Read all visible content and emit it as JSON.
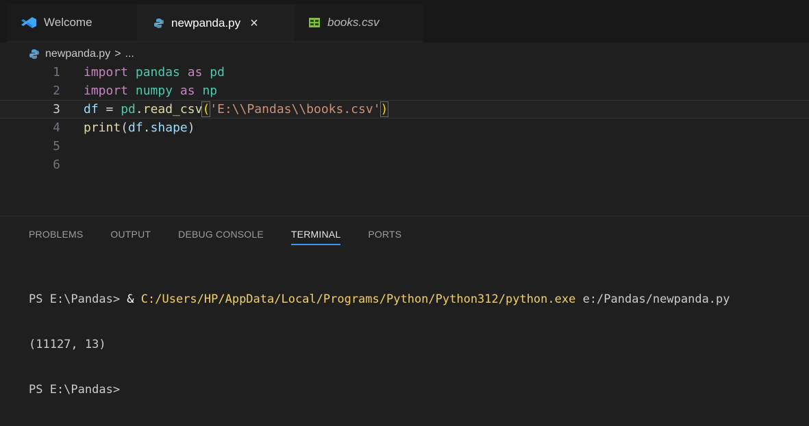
{
  "colors": {
    "background": "#1f1f1f",
    "tabbar": "#181818",
    "accent": "#3794ff",
    "python_icon": "#4da3d6",
    "csv_icon": "#7fbf3f",
    "vscode_icon": "#3ca6ff"
  },
  "tabs": [
    {
      "label": "Welcome",
      "icon": "vscode-icon",
      "active": false
    },
    {
      "label": "newpanda.py",
      "icon": "python-icon",
      "active": true,
      "close": "×"
    },
    {
      "label": "books.csv",
      "icon": "csv-icon",
      "active": false,
      "preview": true
    }
  ],
  "breadcrumb": {
    "file": "newpanda.py",
    "separator": ">",
    "rest": "..."
  },
  "editor": {
    "lines": [
      {
        "number": "1"
      },
      {
        "number": "2"
      },
      {
        "number": "3",
        "current": true
      },
      {
        "number": "4"
      },
      {
        "number": "5"
      },
      {
        "number": "6"
      }
    ],
    "tokens": {
      "l1_import": "import",
      "l1_module": "pandas",
      "l1_as": "as",
      "l1_alias": "pd",
      "l2_import": "import",
      "l2_module": "numpy",
      "l2_as": "as",
      "l2_alias": "np",
      "l3_df": "df",
      "l3_eq": " = ",
      "l3_pd": "pd",
      "l3_dot": ".",
      "l3_fn": "read_csv",
      "l3_open": "(",
      "l3_str": "'E:\\\\Pandas\\\\books.csv'",
      "l3_close": ")",
      "l4_print": "print",
      "l4_open": "(",
      "l4_df": "df",
      "l4_dot": ".",
      "l4_attr": "shape",
      "l4_close": ")"
    }
  },
  "panel": {
    "tabs": [
      "PROBLEMS",
      "OUTPUT",
      "DEBUG CONSOLE",
      "TERMINAL",
      "PORTS"
    ],
    "active_tab": "TERMINAL",
    "terminal": {
      "line1_prompt": "PS E:\\Pandas> ",
      "line1_amp": "& ",
      "line1_exe": "C:/Users/HP/AppData/Local/Programs/Python/Python312/python.exe",
      "line1_arg": " e:/Pandas/newpanda.py",
      "line2": "(11127, 13)",
      "line3": "PS E:\\Pandas>"
    }
  }
}
